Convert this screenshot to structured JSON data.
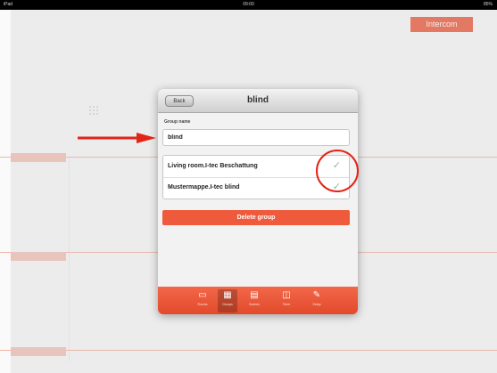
{
  "status_bar": {
    "left": "iPad",
    "time": "09:00",
    "battery": "85%"
  },
  "background": {
    "intercom_button": "Intercom"
  },
  "dialog": {
    "back_label": "Back",
    "title": "blind",
    "group_name_label": "Group name",
    "group_name_value": "blind",
    "items": [
      {
        "label": "Living room.I-tec Beschattung",
        "checked": true
      },
      {
        "label": "Mustermappe.I-tec blind",
        "checked": true
      }
    ],
    "delete_button": "Delete group",
    "tabs": [
      {
        "icon": "tablet-icon",
        "glyph": "▭",
        "label": "Rooms"
      },
      {
        "icon": "groups-icon",
        "glyph": "▦",
        "label": "Groups",
        "active": true
      },
      {
        "icon": "scenes-icon",
        "glyph": "▤",
        "label": "Scenes"
      },
      {
        "icon": "timer-icon",
        "glyph": "◫",
        "label": "Timer"
      },
      {
        "icon": "settings-icon",
        "glyph": "✎",
        "label": "Setup"
      }
    ]
  },
  "annotations": {
    "arrow_color": "#e32418",
    "circle_color": "#e32418"
  },
  "colors": {
    "accent": "#ef5a3c"
  }
}
